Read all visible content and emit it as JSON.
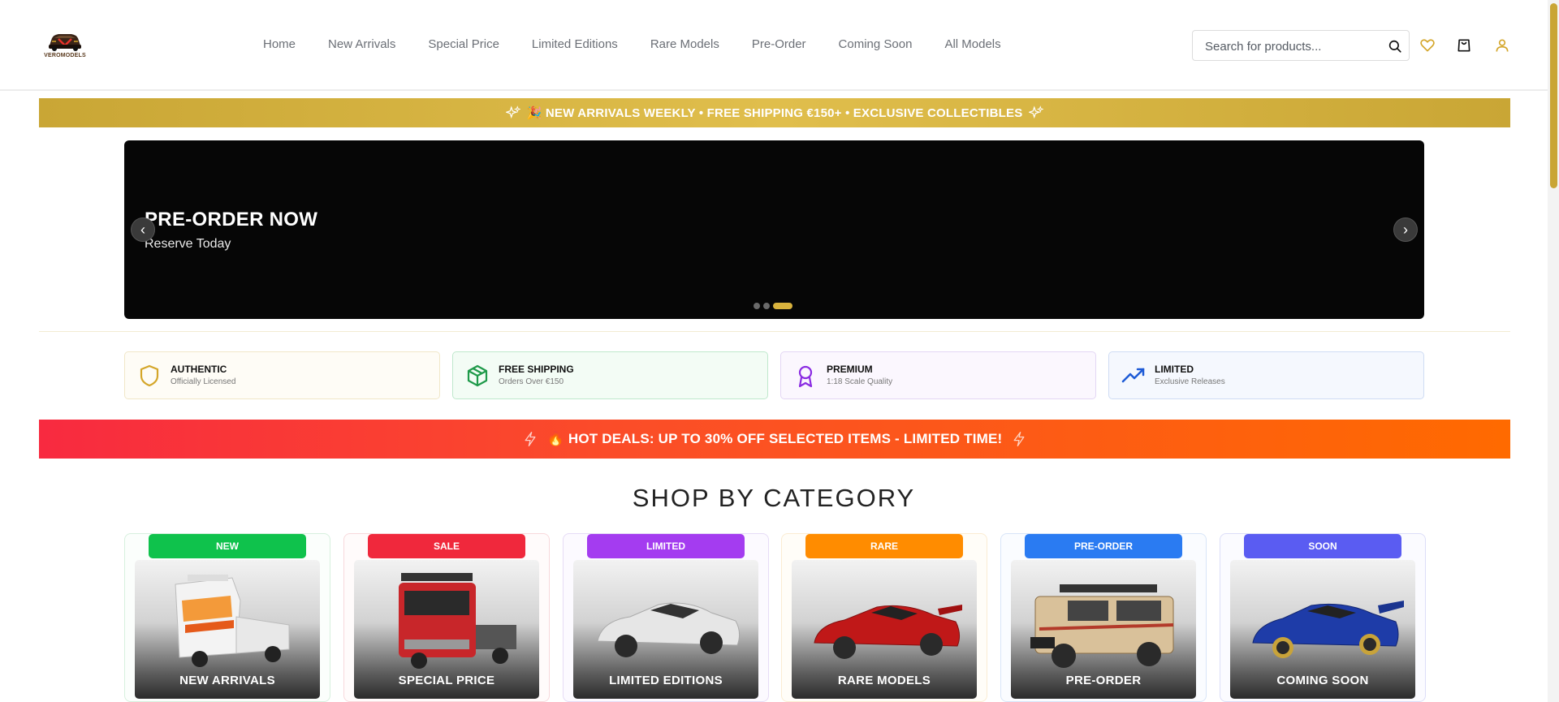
{
  "logo": {
    "brand": "VEROMODELS"
  },
  "nav": {
    "items": [
      "Home",
      "New Arrivals",
      "Special Price",
      "Limited Editions",
      "Rare Models",
      "Pre-Order",
      "Coming Soon",
      "All Models"
    ]
  },
  "search": {
    "placeholder": "Search for products...",
    "icon": "search-icon"
  },
  "header_icons": [
    "heart-icon",
    "shopping-bag-icon",
    "user-icon"
  ],
  "announcement": {
    "text": "🎉 NEW ARRIVALS WEEKLY • FREE SHIPPING €150+ • EXCLUSIVE COLLECTIBLES"
  },
  "hero": {
    "title": "PRE-ORDER NOW",
    "subtitle": "Reserve Today",
    "prev": "‹",
    "next": "›",
    "slide_count": 3,
    "active_slide": 3
  },
  "features": [
    {
      "name": "AUTHENTIC",
      "desc": "Officially Licensed",
      "icon": "shield-icon",
      "color": "#d4a62a"
    },
    {
      "name": "FREE SHIPPING",
      "desc": "Orders Over €150",
      "icon": "box-icon",
      "color": "#1f9a4a"
    },
    {
      "name": "PREMIUM",
      "desc": "1:18 Scale Quality",
      "icon": "award-icon",
      "color": "#8a2be2"
    },
    {
      "name": "LIMITED",
      "desc": "Exclusive Releases",
      "icon": "trending-up-icon",
      "color": "#1e5bd6"
    }
  ],
  "hot_deals": {
    "text": "🔥 HOT DEALS: UP TO 30% OFF SELECTED ITEMS - LIMITED TIME!"
  },
  "categories_section": {
    "title": "SHOP BY CATEGORY",
    "items": [
      {
        "badge": "NEW",
        "label": "NEW ARRIVALS",
        "badge_color": "#0fc24c"
      },
      {
        "badge": "SALE",
        "label": "SPECIAL PRICE",
        "badge_color": "#f0283c"
      },
      {
        "badge": "LIMITED",
        "label": "LIMITED EDITIONS",
        "badge_color": "#a43cf0"
      },
      {
        "badge": "RARE",
        "label": "RARE MODELS",
        "badge_color": "#ff8c00"
      },
      {
        "badge": "PRE-ORDER",
        "label": "PRE-ORDER",
        "badge_color": "#2a7bf2"
      },
      {
        "badge": "SOON",
        "label": "COMING SOON",
        "badge_color": "#5a5cf2"
      }
    ]
  }
}
